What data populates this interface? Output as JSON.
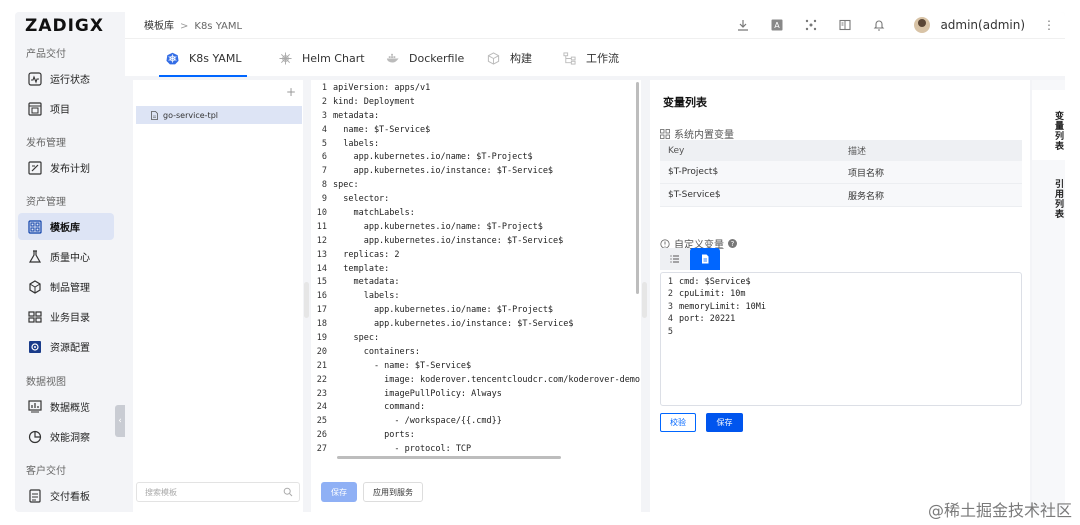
{
  "app": {
    "logo": "ZADIGX"
  },
  "sidebar": {
    "groups": [
      {
        "label": "产品交付",
        "items": [
          {
            "label": "运行状态",
            "icon": "pulse-icon"
          },
          {
            "label": "项目",
            "icon": "project-icon"
          }
        ]
      },
      {
        "label": "发布管理",
        "items": [
          {
            "label": "发布计划",
            "icon": "plan-icon"
          }
        ]
      },
      {
        "label": "资产管理",
        "items": [
          {
            "label": "模板库",
            "icon": "template-icon",
            "active": true
          },
          {
            "label": "质量中心",
            "icon": "flask-icon"
          },
          {
            "label": "制品管理",
            "icon": "artifact-icon"
          },
          {
            "label": "业务目录",
            "icon": "catalog-icon"
          },
          {
            "label": "资源配置",
            "icon": "gear-icon"
          }
        ]
      },
      {
        "label": "数据视图",
        "items": [
          {
            "label": "数据概览",
            "icon": "chart-icon"
          },
          {
            "label": "效能洞察",
            "icon": "pie-icon"
          }
        ]
      },
      {
        "label": "客户交付",
        "items": [
          {
            "label": "交付看板",
            "icon": "board-icon"
          }
        ]
      }
    ]
  },
  "breadcrumb": {
    "root": "模板库",
    "sep": ">",
    "current": "K8s YAML"
  },
  "header": {
    "user": "admin(admin)"
  },
  "tabs": [
    {
      "label": "K8s YAML",
      "icon": "kubernetes-icon",
      "active": true
    },
    {
      "label": "Helm Chart",
      "icon": "helm-icon"
    },
    {
      "label": "Dockerfile",
      "icon": "docker-icon"
    },
    {
      "label": "构建",
      "icon": "build-icon"
    },
    {
      "label": "工作流",
      "icon": "workflow-icon"
    }
  ],
  "filepanel": {
    "add": "+",
    "files": [
      "go-service-tpl"
    ],
    "search_placeholder": "搜索模板"
  },
  "editor": {
    "lines": [
      "apiVersion: apps/v1",
      "kind: Deployment",
      "metadata:",
      "  name: $T-Service$",
      "  labels:",
      "    app.kubernetes.io/name: $T-Project$",
      "    app.kubernetes.io/instance: $T-Service$",
      "spec:",
      "  selector:",
      "    matchLabels:",
      "      app.kubernetes.io/name: $T-Project$",
      "      app.kubernetes.io/instance: $T-Service$",
      "  replicas: 2",
      "  template:",
      "    metadata:",
      "      labels:",
      "        app.kubernetes.io/name: $T-Project$",
      "        app.kubernetes.io/instance: $T-Service$",
      "    spec:",
      "      containers:",
      "        - name: $T-Service$",
      "          image: koderover.tencentcloudcr.com/koderover-demo",
      "          imagePullPolicy: Always",
      "          command:",
      "            - /workspace/{{.cmd}}",
      "          ports:",
      "            - protocol: TCP"
    ],
    "save": "保存",
    "apply": "应用到服务"
  },
  "variables": {
    "title": "变量列表",
    "system_label": "系统内置变量",
    "columns": [
      "Key",
      "描述"
    ],
    "rows": [
      {
        "key": "$T-Project$",
        "desc": "项目名称"
      },
      {
        "key": "$T-Service$",
        "desc": "服务名称"
      }
    ],
    "custom_label": "自定义变量",
    "help": "?",
    "custom_lines": [
      "cmd: $Service$",
      "cpuLimit: 10m",
      "memoryLimit: 10Mi",
      "port: 20221",
      ""
    ],
    "check": "校验",
    "save": "保存"
  },
  "side_tabs": [
    "变量列表",
    "引用列表"
  ],
  "watermark": "@稀土掘金技术社区",
  "colors": {
    "accent": "#0066ff",
    "active_bg": "#dde4f5",
    "disabled_btn": "#8fb0f5"
  }
}
